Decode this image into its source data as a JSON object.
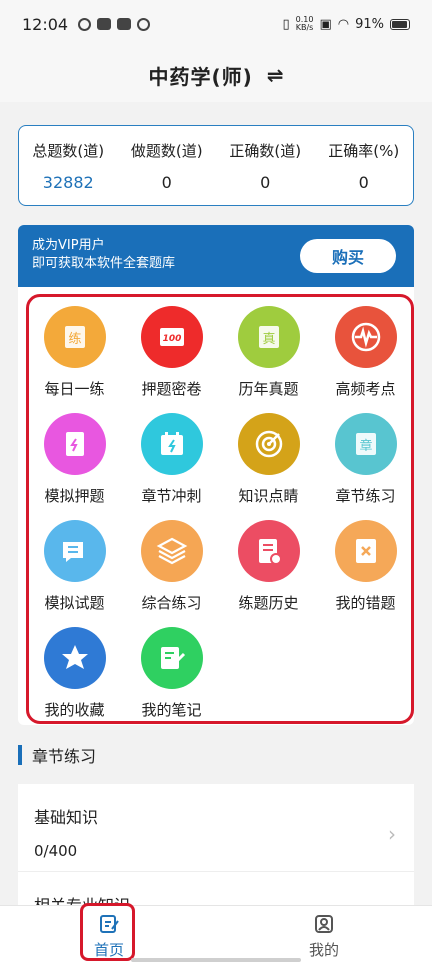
{
  "status_bar": {
    "time": "12:04",
    "net_speed_top": "0.10",
    "net_speed_bottom": "KB/s",
    "battery": "91%"
  },
  "header": {
    "title": "中药学(师)",
    "switch_icon": "⇌"
  },
  "stats": [
    {
      "label": "总题数(道)",
      "value": "32882",
      "color": "#1f72b8"
    },
    {
      "label": "做题数(道)",
      "value": "0"
    },
    {
      "label": "正确数(道)",
      "value": "0"
    },
    {
      "label": "正确率(%)",
      "value": "0"
    }
  ],
  "vip": {
    "line1": "成为VIP用户",
    "line2": "即可获取本软件全套题库",
    "buy_label": "购买",
    "color": "#1a6fb9"
  },
  "grid": [
    {
      "label": "每日一练",
      "icon": "daily-practice-icon",
      "color": "#f3a93a",
      "glyph": "练"
    },
    {
      "label": "押题密卷",
      "icon": "secret-paper-icon",
      "color": "#ee2b2b",
      "glyph": "100"
    },
    {
      "label": "历年真题",
      "icon": "past-exam-icon",
      "color": "#9fcc3e",
      "glyph": "真"
    },
    {
      "label": "高频考点",
      "icon": "heartbeat-icon",
      "color": "#e8533c",
      "glyph": ""
    },
    {
      "label": "模拟押题",
      "icon": "mock-bet-icon",
      "color": "#e857e0",
      "glyph": ""
    },
    {
      "label": "章节冲刺",
      "icon": "calendar-icon",
      "color": "#2fc8dd",
      "glyph": ""
    },
    {
      "label": "知识点睛",
      "icon": "target-icon",
      "color": "#d4a319",
      "glyph": ""
    },
    {
      "label": "章节练习",
      "icon": "chapter-practice-icon",
      "color": "#58c5d0",
      "glyph": "章"
    },
    {
      "label": "模拟试题",
      "icon": "chat-list-icon",
      "color": "#59b7ec",
      "glyph": ""
    },
    {
      "label": "综合练习",
      "icon": "layers-icon",
      "color": "#f5a654",
      "glyph": ""
    },
    {
      "label": "练题历史",
      "icon": "history-doc-icon",
      "color": "#ec4d63",
      "glyph": ""
    },
    {
      "label": "我的错题",
      "icon": "wrong-notebook-icon",
      "color": "#f5a858",
      "glyph": ""
    },
    {
      "label": "我的收藏",
      "icon": "star-icon",
      "color": "#2f7ad5",
      "glyph": ""
    },
    {
      "label": "我的笔记",
      "icon": "note-edit-icon",
      "color": "#2fd061",
      "glyph": ""
    }
  ],
  "section": {
    "title": "章节练习"
  },
  "chapters": [
    {
      "name": "基础知识",
      "progress": "0/400"
    },
    {
      "name": "相关专业知识",
      "progress": ""
    }
  ],
  "tabbar": {
    "home_label": "首页",
    "mine_label": "我的",
    "active_color": "#1f72b8"
  }
}
